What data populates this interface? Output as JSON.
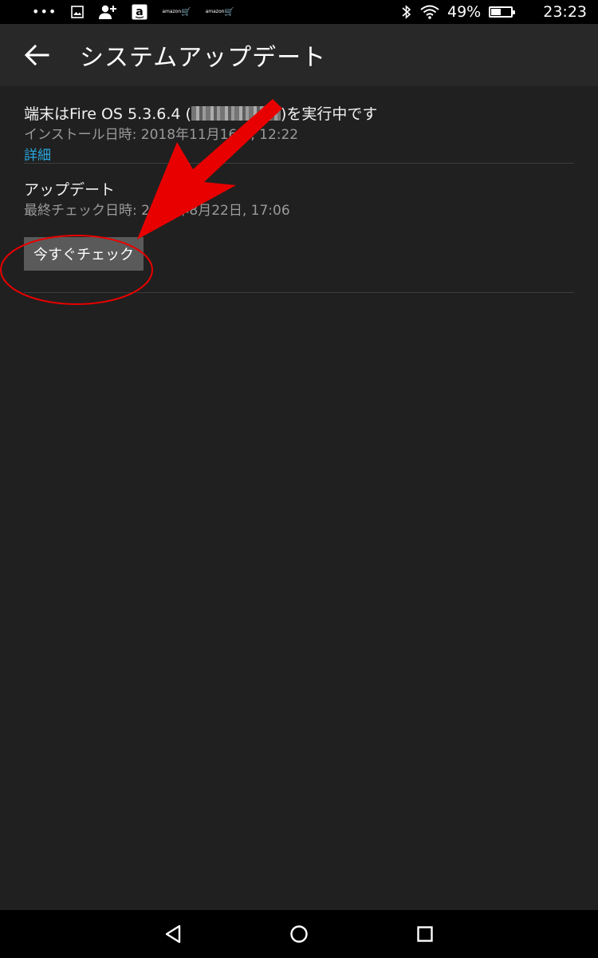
{
  "status_bar": {
    "notification_icons": [
      "overflow-dots-icon",
      "image-icon",
      "add-person-icon",
      "amazon-app-icon",
      "amazon-cart-icon",
      "amazon-cart-icon"
    ],
    "amazon_label": "amazon",
    "battery_percent": 49,
    "battery_text": "49%",
    "time": "23:23"
  },
  "app_bar": {
    "title": "システムアップデート"
  },
  "os_section": {
    "running_prefix": "端末はFire OS 5.3.6.4 (",
    "running_suffix": ")を実行中です",
    "install_label": "インストール日時: 2018年11月16日, 12:22",
    "details_link": "詳細"
  },
  "update_section": {
    "heading": "アップデート",
    "last_check": "最終チェック日時: 2019年8月22日, 17:06",
    "check_now_button": "今すぐチェック"
  },
  "colors": {
    "background": "#202020",
    "app_bar": "#282828",
    "link": "#29a7df",
    "button": "#5a5a5a",
    "annotation": "#e80000"
  }
}
